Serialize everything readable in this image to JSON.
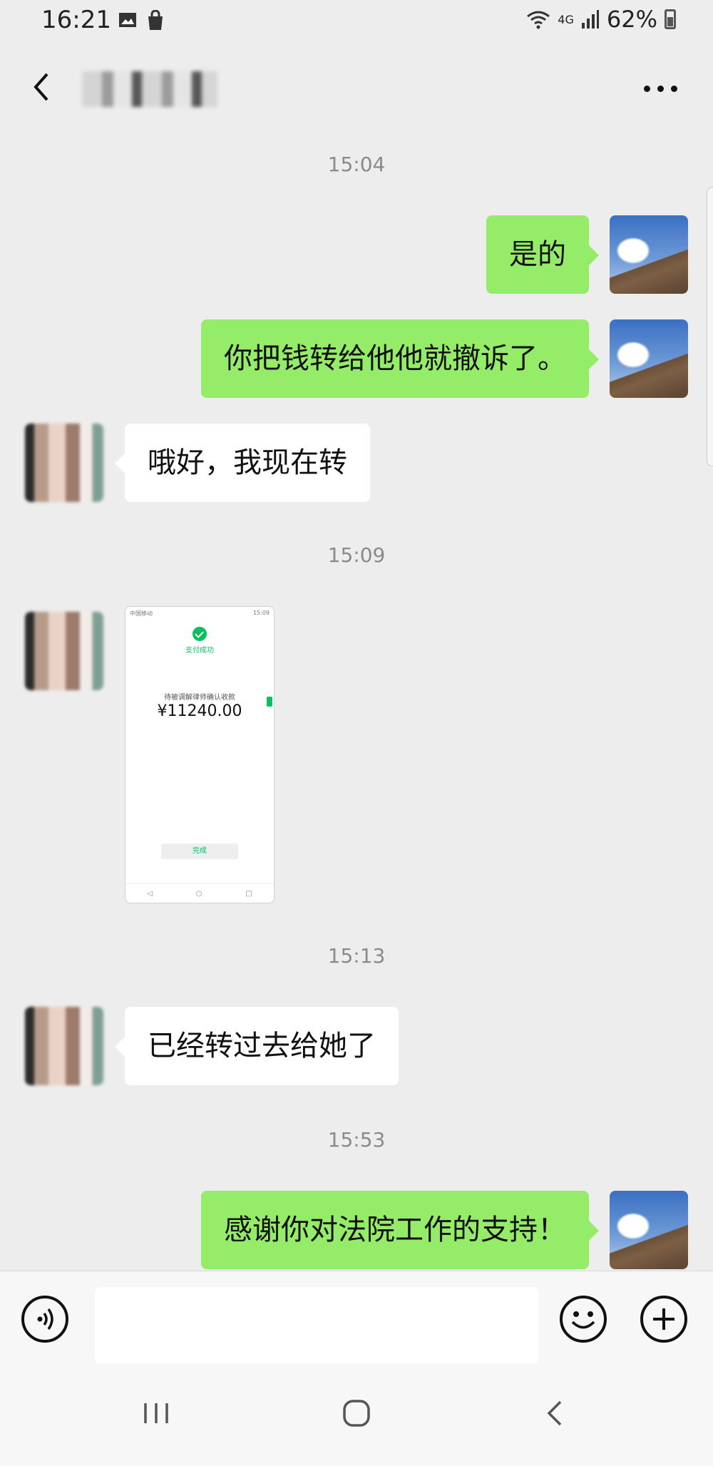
{
  "status_bar": {
    "time": "16:21",
    "network": "4G",
    "battery": "62%"
  },
  "header": {
    "back_icon": "chevron-left-icon",
    "more_icon": "more-horizontal-icon"
  },
  "messages": [
    {
      "time": "15:04"
    },
    {
      "side": "sent",
      "text": "是的"
    },
    {
      "side": "sent",
      "text": "你把钱转给他他就撤诉了。"
    },
    {
      "side": "received",
      "text": "哦好，我现在转"
    },
    {
      "time": "15:09"
    },
    {
      "side": "received",
      "type": "image"
    },
    {
      "time": "15:13"
    },
    {
      "side": "received",
      "text": "已经转过去给她了"
    },
    {
      "time": "15:53"
    },
    {
      "side": "sent",
      "text": "感谢你对法院工作的支持！"
    }
  ],
  "screenshot": {
    "status_left": "中国移动",
    "status_right": "15:09",
    "success_text": "支付成功",
    "payee_text": "待被调解律师确认收款",
    "amount": "¥11240.00",
    "done_button": "完成",
    "nav_back": "◁",
    "nav_home": "○",
    "nav_recent": "□"
  },
  "input_bar": {
    "voice_icon": "voice-icon",
    "input_value": "",
    "emoji_icon": "emoji-icon",
    "plus_icon": "plus-icon"
  },
  "nav_bar": {
    "recents_icon": "recents-icon",
    "home_icon": "home-icon",
    "back_icon": "back-icon"
  }
}
